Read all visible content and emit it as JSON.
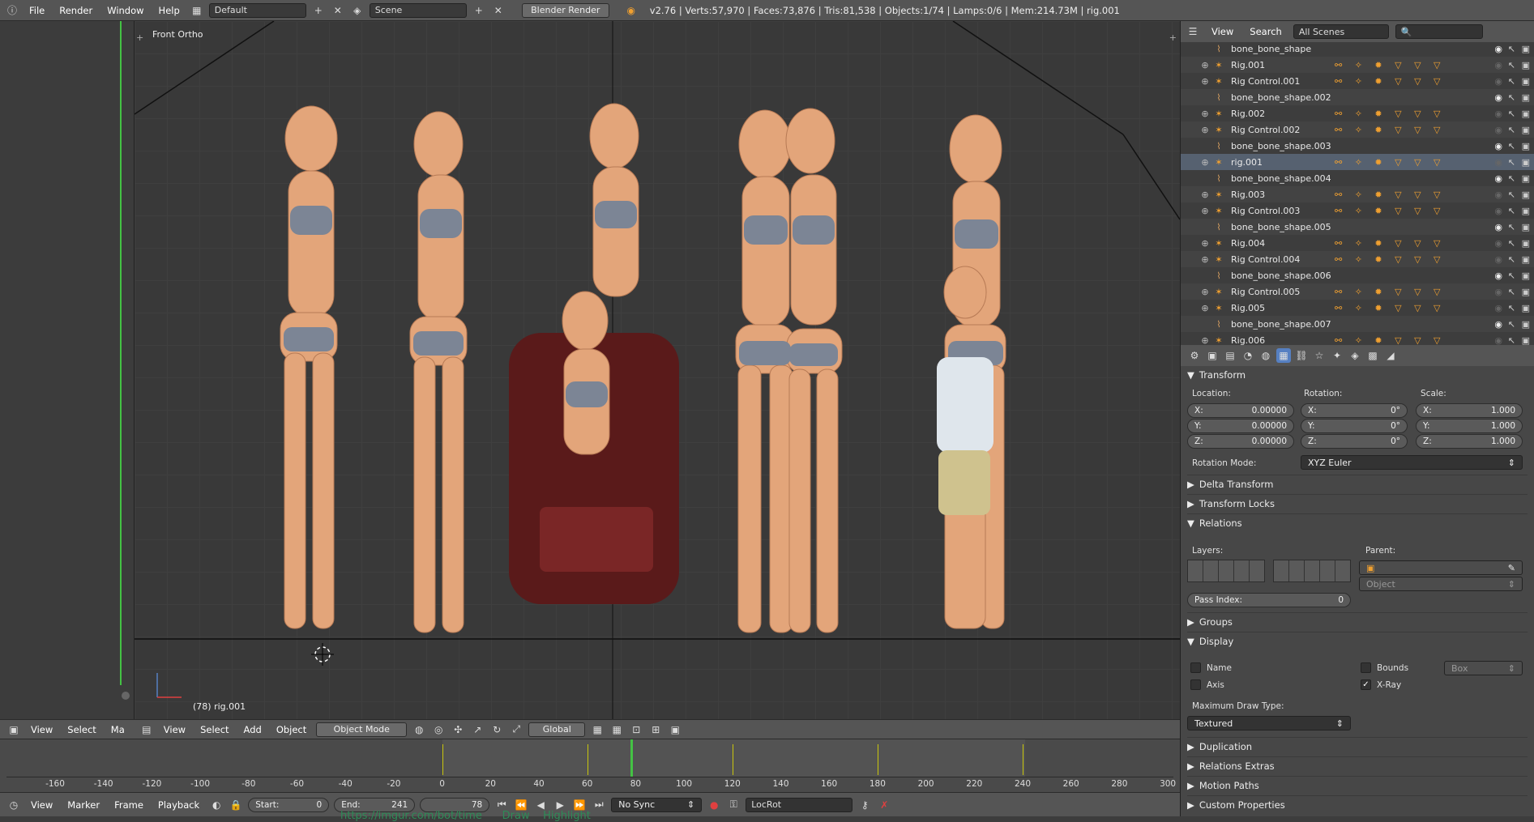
{
  "topbar": {
    "menus": [
      "File",
      "Render",
      "Window",
      "Help"
    ],
    "layout": "Default",
    "scene": "Scene",
    "engine": "Blender Render",
    "stats": "v2.76 | Verts:57,970 | Faces:73,876 | Tris:81,538 | Objects:1/74 | Lamps:0/6 | Mem:214.73M | rig.001"
  },
  "viewport": {
    "view_label": "Front Ortho",
    "frame_info": "(78) rig.001"
  },
  "viewport_header": {
    "menus": [
      "View",
      "Select",
      "Add",
      "Object"
    ],
    "left_menus": [
      "View",
      "Select",
      "Ma"
    ],
    "mode": "Object Mode",
    "orientation": "Global"
  },
  "outliner": {
    "menus": [
      "View",
      "Search"
    ],
    "filter": "All Scenes",
    "items": [
      {
        "name": "bone_bone_shape",
        "kind": "bone",
        "vis": true
      },
      {
        "name": "Rig.001",
        "kind": "rig"
      },
      {
        "name": "Rig Control.001",
        "kind": "rig"
      },
      {
        "name": "bone_bone_shape.002",
        "kind": "bone",
        "vis": true
      },
      {
        "name": "Rig.002",
        "kind": "rig"
      },
      {
        "name": "Rig Control.002",
        "kind": "rig"
      },
      {
        "name": "bone_bone_shape.003",
        "kind": "bone",
        "vis": true
      },
      {
        "name": "rig.001",
        "kind": "rig",
        "selected": true
      },
      {
        "name": "bone_bone_shape.004",
        "kind": "bone",
        "vis": true
      },
      {
        "name": "Rig.003",
        "kind": "rig"
      },
      {
        "name": "Rig Control.003",
        "kind": "rig"
      },
      {
        "name": "bone_bone_shape.005",
        "kind": "bone",
        "vis": true
      },
      {
        "name": "Rig.004",
        "kind": "rig"
      },
      {
        "name": "Rig Control.004",
        "kind": "rig"
      },
      {
        "name": "bone_bone_shape.006",
        "kind": "bone",
        "vis": true
      },
      {
        "name": "Rig Control.005",
        "kind": "rig"
      },
      {
        "name": "Rig.005",
        "kind": "rig"
      },
      {
        "name": "bone_bone_shape.007",
        "kind": "bone",
        "vis": true
      },
      {
        "name": "Rig.006",
        "kind": "rig"
      }
    ]
  },
  "properties": {
    "transform_title": "Transform",
    "location_label": "Location:",
    "rotation_label": "Rotation:",
    "scale_label": "Scale:",
    "location": {
      "x": "0.00000",
      "y": "0.00000",
      "z": "0.00000"
    },
    "rotation": {
      "x": "0°",
      "y": "0°",
      "z": "0°"
    },
    "scale": {
      "x": "1.000",
      "y": "1.000",
      "z": "1.000"
    },
    "rotation_mode_label": "Rotation Mode:",
    "rotation_mode": "XYZ Euler",
    "delta_transform": "Delta Transform",
    "transform_locks": "Transform Locks",
    "relations": "Relations",
    "layers_label": "Layers:",
    "parent_label": "Parent:",
    "parent_type": "Object",
    "pass_index_label": "Pass Index:",
    "pass_index": "0",
    "groups": "Groups",
    "display": "Display",
    "name_label": "Name",
    "bounds_label": "Bounds",
    "bounds_type": "Box",
    "axis_label": "Axis",
    "xray_label": "X-Ray",
    "max_draw_label": "Maximum Draw Type:",
    "max_draw": "Textured",
    "duplication": "Duplication",
    "relations_extras": "Relations Extras",
    "motion_paths": "Motion Paths",
    "custom_properties": "Custom Properties"
  },
  "timeline": {
    "ticks": [
      "-160",
      "-140",
      "-120",
      "-100",
      "-80",
      "-60",
      "-40",
      "-20",
      "0",
      "20",
      "40",
      "60",
      "80",
      "100",
      "120",
      "140",
      "160",
      "180",
      "200",
      "220",
      "240",
      "260",
      "280",
      "300"
    ],
    "current_frame": 78,
    "menus": [
      "View",
      "Marker",
      "Frame",
      "Playback"
    ],
    "start_label": "Start:",
    "start": "0",
    "end_label": "End:",
    "end": "241",
    "frame": "78",
    "sync": "No Sync",
    "keying_set": "LocRot",
    "bottom_overlay": "https://imgur.com/bot/time      Draw    Highlight"
  },
  "colors": {
    "accent": "#5680c2",
    "selected": "#566170",
    "keyframe": "#c7c300",
    "playhead": "#44c244"
  }
}
